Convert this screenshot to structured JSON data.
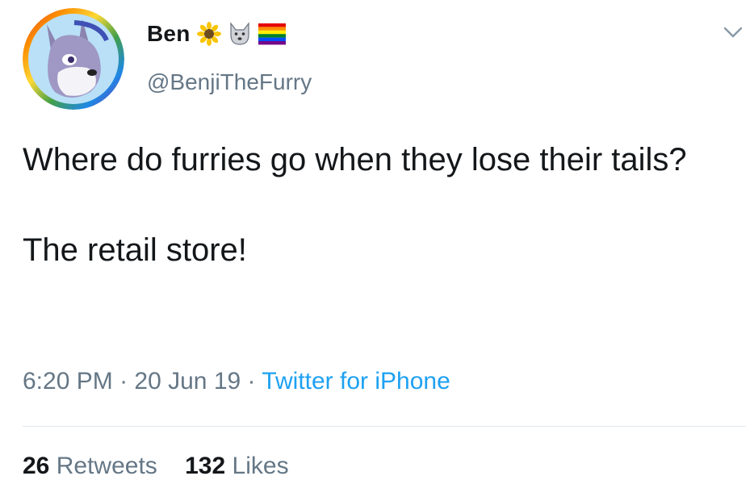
{
  "user": {
    "display_name": "Ben",
    "handle": "@BenjiTheFurry",
    "badges": [
      "sunflower-icon",
      "wolf-icon",
      "rainbow-flag-icon"
    ]
  },
  "tweet": {
    "line1": "Where do furries go when they lose their tails?",
    "line2": "The retail store!"
  },
  "meta": {
    "time": "6:20 PM",
    "separator": " · ",
    "date": "20 Jun 19",
    "source": "Twitter for iPhone"
  },
  "stats": {
    "retweets_count": "26",
    "retweets_label": "Retweets",
    "likes_count": "132",
    "likes_label": "Likes"
  },
  "colors": {
    "text": "#14171a",
    "secondary": "#657786",
    "link": "#1da1f2",
    "divider": "#e1e8ed"
  }
}
